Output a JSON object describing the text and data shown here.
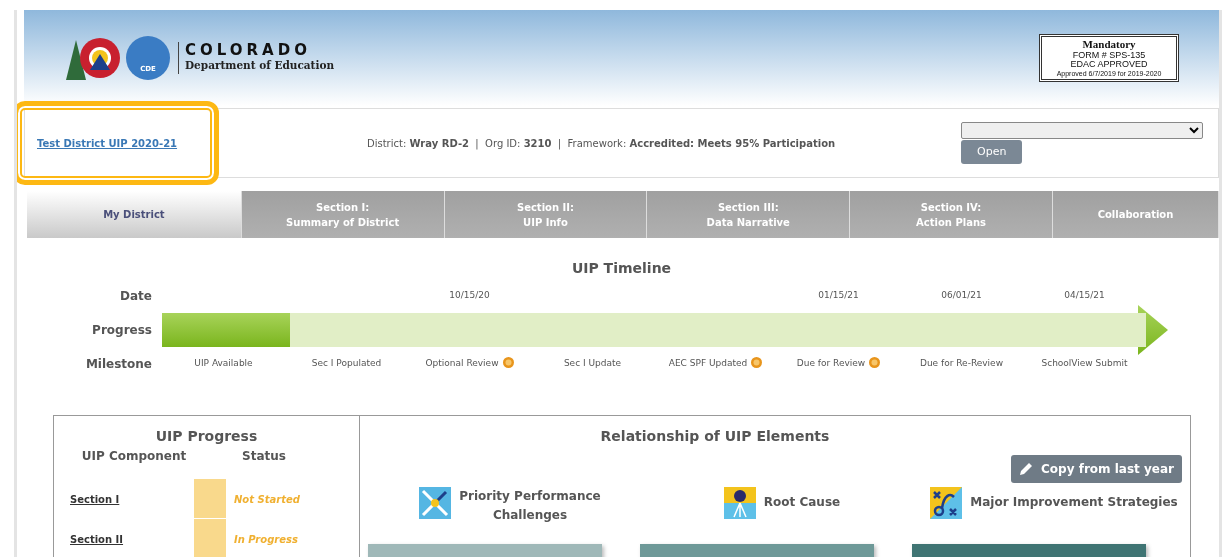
{
  "header": {
    "logo_word": "COLORADO",
    "logo_sub": "Department of Education",
    "logo_badge": "CDE",
    "stamp": [
      "Mandatory",
      "FORM # SPS-135",
      "EDAC APPROVED",
      "Approved 6/7/2019 for 2019-2020"
    ]
  },
  "info_bar": {
    "plan_link": "Test District UIP 2020-21",
    "highlighted": true,
    "details": "District: **Wray RD-2**  |  Org ID: **3210**  |  Framework: **Accredited: Meets 95% Participation**",
    "open_button": "Open"
  },
  "tabs": [
    {
      "lines": [
        "My District"
      ],
      "selected": true
    },
    {
      "lines": [
        "Section I:",
        "Summary of District"
      ],
      "selected": false
    },
    {
      "lines": [
        "Section II:",
        "UIP Info"
      ],
      "selected": false
    },
    {
      "lines": [
        "Section III:",
        "Data Narrative"
      ],
      "selected": false
    },
    {
      "lines": [
        "Section IV:",
        "Action Plans"
      ],
      "selected": false
    },
    {
      "lines": [
        "Collaboration"
      ],
      "selected": false
    }
  ],
  "timeline": {
    "title": "UIP Timeline",
    "date_label": "Date",
    "progress_label": "Progress",
    "milestone_label": "Milestone",
    "level": 0.13,
    "milestones": [
      {
        "name": "UIP Available",
        "help": false
      },
      {
        "name": "Sec I Populated",
        "help": false
      },
      {
        "name": "Optional Review",
        "date": "10/15/20",
        "help": true
      },
      {
        "name": "Sec I Update",
        "help": false
      },
      {
        "name": "AEC SPF Updated",
        "help": true
      },
      {
        "name": "Due for Review",
        "date": "01/15/21",
        "help": true
      },
      {
        "name": "Due for Re-Review",
        "date": "06/01/21",
        "help": false
      },
      {
        "name": "SchoolView Submit",
        "date": "04/15/21",
        "help": false
      }
    ]
  },
  "uip_progress": {
    "title": "UIP Progress",
    "columns": [
      "UIP Component",
      "Status"
    ],
    "rows": [
      {
        "component": "Section I",
        "status": "Not Started",
        "color": "#f9d98c"
      },
      {
        "component": "Section II",
        "status": "In Progress",
        "color": "#f9d98c"
      }
    ]
  },
  "relationship": {
    "title": "Relationship of UIP Elements",
    "copy_button": "Copy from last year",
    "elements": [
      {
        "kind": "challenges",
        "lines": [
          "Priority Performance",
          "Challenges"
        ],
        "color": "#9fb8b8"
      },
      {
        "kind": "root",
        "lines": [
          "Root Cause"
        ],
        "color": "#6e9998"
      },
      {
        "kind": "strategies",
        "lines": [
          "Major Improvement Strategies"
        ],
        "color": "#3f7473"
      }
    ]
  }
}
